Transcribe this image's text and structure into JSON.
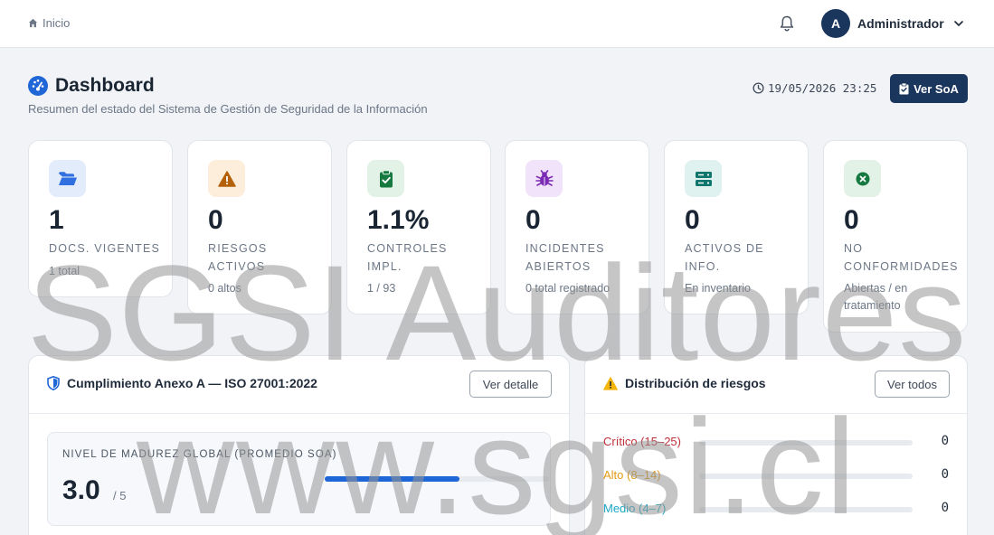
{
  "topbar": {
    "breadcrumb": "Inicio",
    "user_initial": "A",
    "user_name": "Administrador"
  },
  "header": {
    "title": "Dashboard",
    "subtitle": "Resumen del estado del Sistema de Gestión de Seguridad de la Información",
    "datetime": "19/05/2026 23:25",
    "soa_button": "Ver SoA"
  },
  "stats": [
    {
      "icon": "folder-open-icon",
      "value": "1",
      "label": "DOCS. VIGENTES",
      "sub": "1 total",
      "icon_color": "#2f6fe0",
      "icon_bg": "#e3ecfb"
    },
    {
      "icon": "warning-icon",
      "value": "0",
      "label": "RIESGOS ACTIVOS",
      "sub": "0 altos",
      "icon_color": "#b4610a",
      "icon_bg": "#fdeedb"
    },
    {
      "icon": "clipboard-check-icon",
      "value": "1.1%",
      "label": "CONTROLES IMPL.",
      "sub": "1 / 93",
      "icon_color": "#16793f",
      "icon_bg": "#e2f2e7"
    },
    {
      "icon": "bug-icon",
      "value": "0",
      "label": "INCIDENTES ABIERTOS",
      "sub": "0 total registrado",
      "icon_color": "#7b2bb3",
      "icon_bg": "#f1e3fa"
    },
    {
      "icon": "server-icon",
      "value": "0",
      "label": "ACTIVOS DE INFO.",
      "sub": "En inventario",
      "icon_color": "#0f766e",
      "icon_bg": "#dff2f0"
    },
    {
      "icon": "x-circle-icon",
      "value": "0",
      "label": "NO CONFORMIDADES",
      "sub": "Abiertas / en tratamiento",
      "icon_color": "#16793f",
      "icon_bg": "#e2f2e7"
    }
  ],
  "compliance": {
    "title": "Cumplimiento Anexo A — ISO 27001:2022",
    "button": "Ver detalle",
    "maturity_label": "NIVEL DE MADUREZ GLOBAL (PROMEDIO SOA)",
    "maturity_value": "3.0",
    "maturity_max": "/ 5",
    "maturity_fraction": 0.6
  },
  "risks": {
    "title": "Distribución de riesgos",
    "button": "Ver todos",
    "rows": [
      {
        "label": "Crítico (15–25)",
        "value": "0",
        "color": "#c0303a"
      },
      {
        "label": "Alto (8–14)",
        "value": "0",
        "color": "#e39b16"
      },
      {
        "label": "Medio (4–7)",
        "value": "0",
        "color": "#1aa7c6"
      }
    ]
  },
  "watermark": {
    "line1": "SGSI Auditores",
    "line2": "www.sgsi.cl"
  },
  "colors": {
    "primary": "#1b365d",
    "accent_blue": "#1f66d6",
    "warning": "#f5b50a"
  }
}
